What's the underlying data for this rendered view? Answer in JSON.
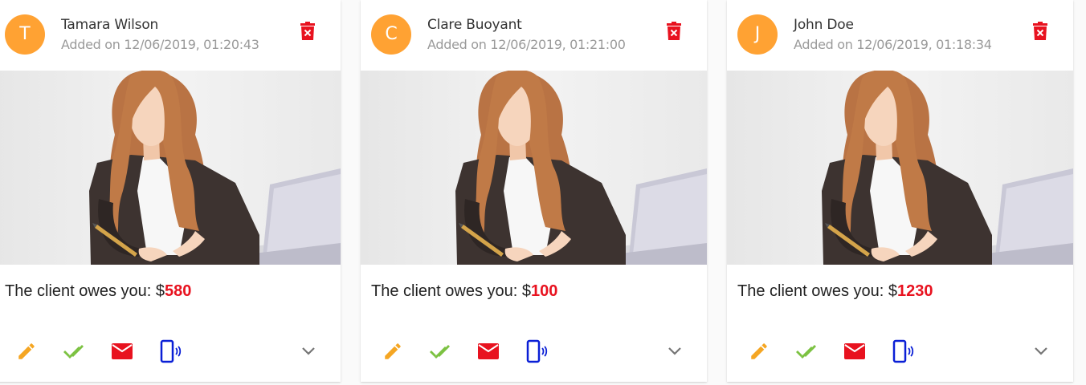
{
  "cards": [
    {
      "initial": "T",
      "name": "Tamara Wilson",
      "added": "Added on 12/06/2019, 01:20:43",
      "owes_label": "The client owes you: $",
      "amount": "580"
    },
    {
      "initial": "C",
      "name": "Clare Buoyant",
      "added": "Added on 12/06/2019, 01:21:00",
      "owes_label": "The client owes you: $",
      "amount": "100"
    },
    {
      "initial": "J",
      "name": "John Doe",
      "added": "Added on 12/06/2019, 01:18:34",
      "owes_label": "The client owes you: $",
      "amount": "1230"
    }
  ],
  "icons": {
    "delete": "delete-forever-icon",
    "edit": "pencil-icon",
    "done": "double-check-icon",
    "email": "mail-icon",
    "phone": "phone-icon",
    "expand": "chevron-down-icon"
  },
  "colors": {
    "avatar": "#ffa233",
    "amount": "#e8121f",
    "delete": "#e8121f",
    "edit": "#f5a623",
    "done": "#7cc242",
    "email": "#e8121f",
    "phone": "#0a1fd6",
    "expand": "#757575"
  }
}
